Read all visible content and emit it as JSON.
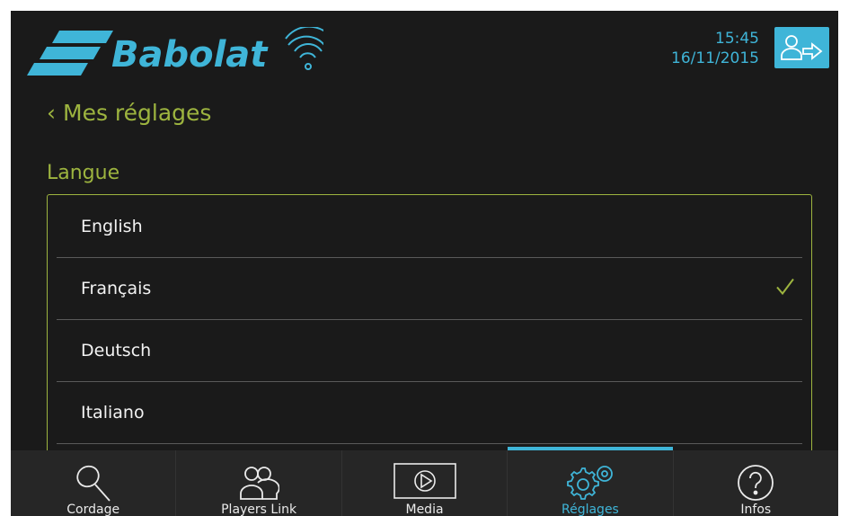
{
  "header": {
    "brand": "Babolat",
    "time": "15:45",
    "date": "16/11/2015"
  },
  "page": {
    "back_label": "Mes réglages",
    "section_title": "Langue"
  },
  "languages": [
    {
      "label": "English",
      "selected": false
    },
    {
      "label": "Français",
      "selected": true
    },
    {
      "label": "Deutsch",
      "selected": false
    },
    {
      "label": "Italiano",
      "selected": false
    }
  ],
  "nav": [
    {
      "label": "Cordage",
      "icon": "racket-icon",
      "active": false
    },
    {
      "label": "Players Link",
      "icon": "players-icon",
      "active": false
    },
    {
      "label": "Media",
      "icon": "play-icon",
      "active": false
    },
    {
      "label": "Réglages",
      "icon": "gears-icon",
      "active": true
    },
    {
      "label": "Infos",
      "icon": "help-icon",
      "active": false
    }
  ],
  "colors": {
    "accent_blue": "#3fb5d8",
    "accent_green": "#9db43f",
    "background": "#1a1a1a"
  }
}
